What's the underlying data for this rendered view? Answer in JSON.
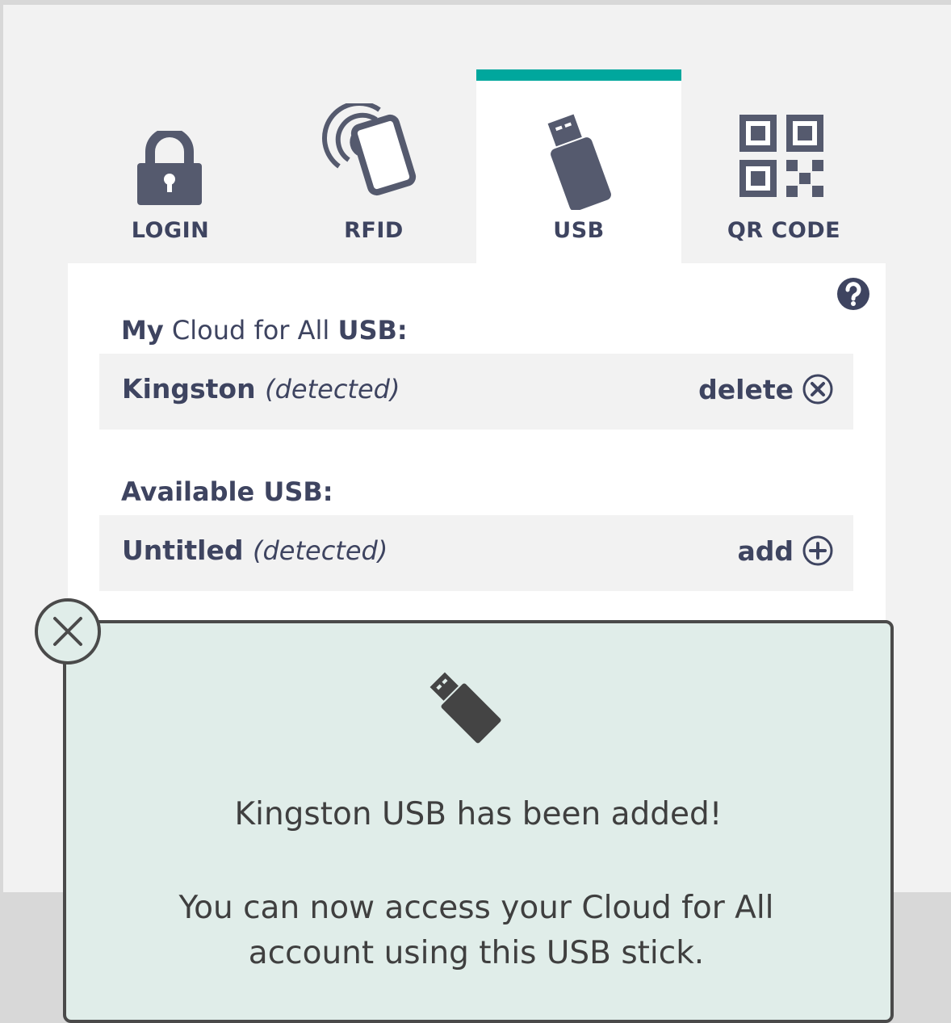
{
  "colors": {
    "accent": "#00a79d",
    "text": "#3e4460",
    "icon": "#555a6e",
    "dialog_bg": "#e0ede9",
    "dialog_border": "#4a4a4a"
  },
  "tabs": [
    {
      "label": "LOGIN",
      "icon": "lock-icon",
      "active": false
    },
    {
      "label": "RFID",
      "icon": "rfid-card-icon",
      "active": false
    },
    {
      "label": "USB",
      "icon": "usb-stick-icon",
      "active": true
    },
    {
      "label": "QR CODE",
      "icon": "qr-code-icon",
      "active": false
    }
  ],
  "help": {
    "icon": "help-icon"
  },
  "my_usb": {
    "label_prefix": "My",
    "label_middle": "Cloud for All",
    "label_suffix": "USB:",
    "items": [
      {
        "name": "Kingston",
        "status": "(detected)",
        "action": "delete",
        "action_icon": "circle-x-icon"
      }
    ]
  },
  "available_usb": {
    "label": "Available USB:",
    "items": [
      {
        "name": "Untitled",
        "status": "(detected)",
        "action": "add",
        "action_icon": "circle-plus-icon"
      }
    ]
  },
  "dialog": {
    "icon": "usb-stick-icon",
    "title": "Kingston USB has been added!",
    "message": "You can now access your Cloud for All account using this USB stick.",
    "close_icon": "close-icon"
  }
}
